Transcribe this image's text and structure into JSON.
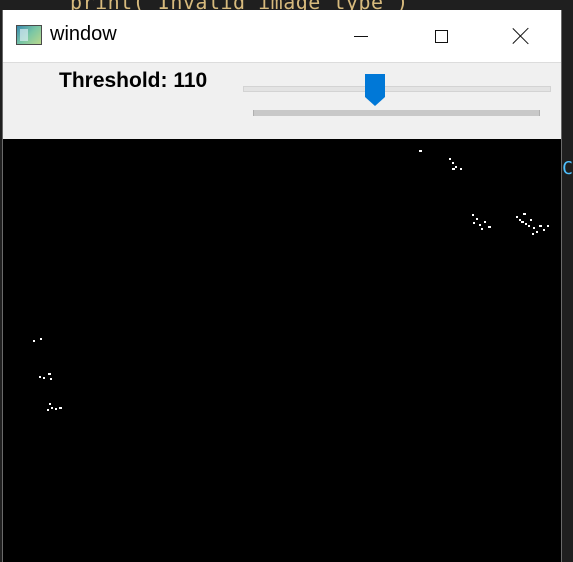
{
  "background_editor": {
    "code_snippet": "print(\"Invalid image type\")"
  },
  "window": {
    "title": "window",
    "icon": "opencv-window-icon",
    "controls": {
      "minimize": "minimize-icon",
      "maximize": "maximize-icon",
      "close": "close-icon"
    }
  },
  "trackbar": {
    "label": "Threshold: 110",
    "value": 110,
    "min": 0,
    "max": 255,
    "thumb_color": "#0078d7"
  },
  "image": {
    "background_color": "#000000",
    "content": "thresholded binary image, mostly black with sparse white specks"
  }
}
